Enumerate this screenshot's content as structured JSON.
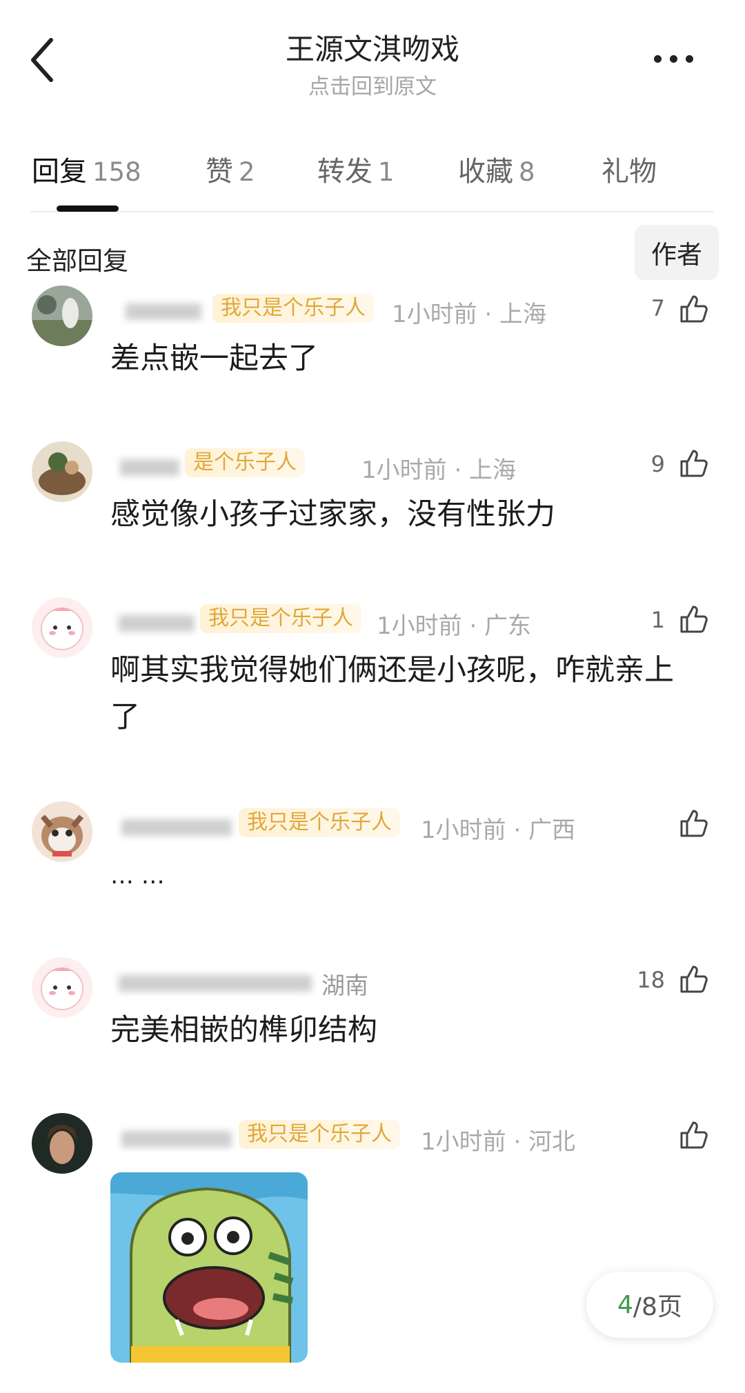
{
  "header": {
    "title": "王源文淇吻戏",
    "subtitle": "点击回到原文",
    "back_icon": "chevron-left-icon",
    "more_icon": "more-dots-icon"
  },
  "tabs": [
    {
      "label": "回复",
      "count": "158"
    },
    {
      "label": "赞",
      "count": "2"
    },
    {
      "label": "转发",
      "count": "1"
    },
    {
      "label": "收藏",
      "count": "8"
    },
    {
      "label": "礼物",
      "count": ""
    }
  ],
  "filter": {
    "all_label": "全部回复",
    "author_label": "作者"
  },
  "comments": [
    {
      "badge": "我只是个乐子人",
      "meta": "1小时前 · 上海",
      "likes": "7",
      "text": "差点嵌一起去了"
    },
    {
      "badge": "是个乐子人",
      "meta": "1小时前 · 上海",
      "likes": "9",
      "text": "感觉像小孩子过家家，没有性张力"
    },
    {
      "badge": "我只是个乐子人",
      "meta": "1小时前 · 广东",
      "likes": "1",
      "text": "啊其实我觉得她们俩还是小孩呢，咋就亲上了"
    },
    {
      "badge": "我只是个乐子人",
      "meta": "1小时前 · 广西",
      "likes": "",
      "text": "… …"
    },
    {
      "badge": "",
      "meta": "湖南",
      "likes": "18",
      "text": "完美相嵌的榫卯结构"
    },
    {
      "badge": "我只是个乐子人",
      "meta": "1小时前 · 河北",
      "likes": "",
      "text": ""
    }
  ],
  "pager": {
    "current": "4",
    "total": "/8页"
  },
  "colors": {
    "badge_text": "#e1a73a",
    "pager_current": "#3b9b4a"
  }
}
